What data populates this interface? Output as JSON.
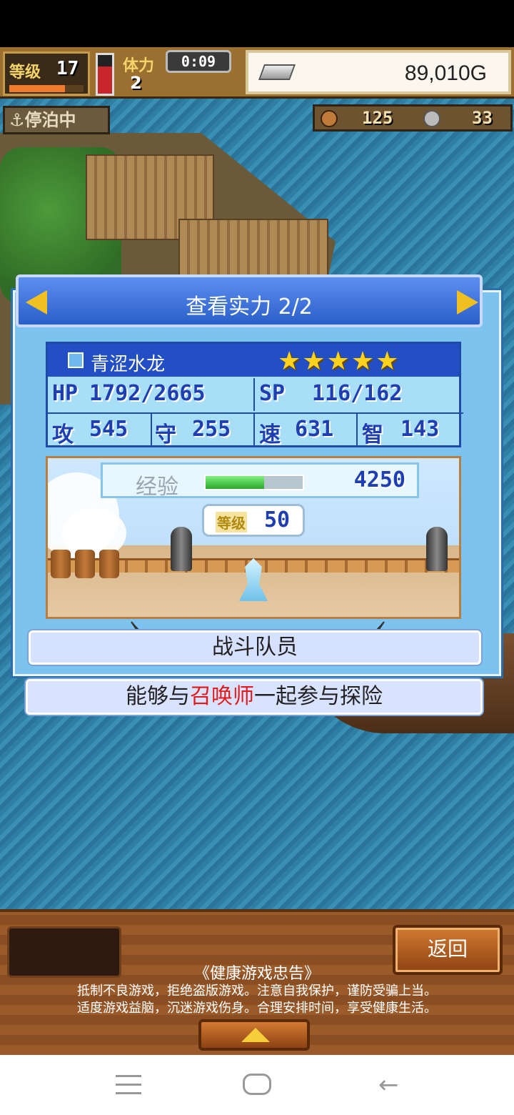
{
  "hud": {
    "level_label": "等级",
    "level_value": "17",
    "level_progress": 0.75,
    "stamina_label": "体力",
    "stamina_value": "2",
    "stamina_level": 0.7,
    "timer": "0:09",
    "gold": "89,010G"
  },
  "status_tag": "停泊中",
  "resources": {
    "first": "125",
    "second": "33"
  },
  "panel": {
    "title": "查看实力 2/2",
    "unit_name": "青涩水龙",
    "stars": "★★★★★",
    "stats": {
      "hp_label": "HP",
      "hp_value": "1792/2665",
      "sp_label": "SP",
      "sp_value": "116/162",
      "atk_label": "攻",
      "atk_value": "545",
      "def_label": "守",
      "def_value": "255",
      "spd_label": "速",
      "spd_value": "631",
      "int_label": "智",
      "int_value": "143"
    },
    "exp_label": "经验",
    "exp_progress": 0.6,
    "exp_value": "4250",
    "level_label": "等级",
    "level_value": "50",
    "role": "战斗队员",
    "desc_prefix": "能够与",
    "desc_highlight": "召唤师",
    "desc_suffix": "一起参与探险"
  },
  "footer": {
    "back_label": "返回",
    "advice_title": "《健康游戏忠告》",
    "advice_line1": "抵制不良游戏，拒绝盗版游戏。注意自我保护，谨防受骗上当。",
    "advice_line2": "适度游戏益脑，沉迷游戏伤身。合理安排时间，享受健康生活。"
  },
  "colors": {
    "accent_blue": "#234fc4",
    "highlight_red": "#e21a1a",
    "gold_star": "#ffd21e"
  },
  "icons": [
    "anchor-icon",
    "silver-bar-icon",
    "arrow-left-icon",
    "arrow-right-icon",
    "sword-icon",
    "up-arrow-icon"
  ]
}
